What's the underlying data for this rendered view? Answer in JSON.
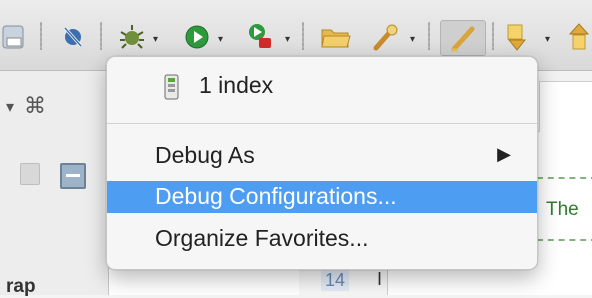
{
  "toolbar": {
    "icons": [
      "server-icon",
      "skip-breakpoints-icon",
      "debug-icon",
      "run-icon",
      "run-external-tool-icon",
      "open-folder-icon",
      "search-icon",
      "highlight-icon",
      "next-annotation-icon",
      "previous-annotation-icon"
    ],
    "dropdown_glyph": "▾"
  },
  "left_view": {
    "chevron": "▾",
    "close_glyph": "⌘",
    "wrap_text": "rap"
  },
  "editor": {
    "green_text": "The",
    "line_number": "14",
    "cursor_char": "I"
  },
  "menu": {
    "items": [
      {
        "label": "1 index"
      },
      {
        "label": "Debug As",
        "submenu_arrow": "▶"
      },
      {
        "label": "Debug Configurations..."
      },
      {
        "label": "Organize Favorites..."
      }
    ]
  },
  "colors": {
    "highlight": "#4d9df2",
    "menu_background": "#f6f6f6"
  }
}
